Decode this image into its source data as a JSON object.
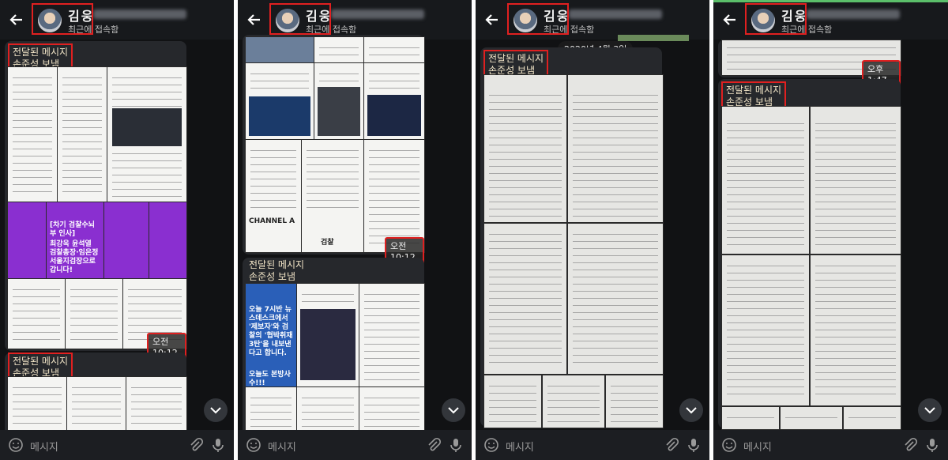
{
  "chat": {
    "contact_name": "김웅",
    "status": "최근에 접속함",
    "input_placeholder": "메시지",
    "forwarded_from": "전달된 메시지\n손준성 보냄"
  },
  "panels": [
    {
      "timestamps": [
        "오전 10:12"
      ]
    },
    {
      "timestamps": [
        "오전 10:12"
      ],
      "tile_texts": [
        "[차기 검찰수뇌부 인사]",
        "최강욱 윤석열 검찰총장·임은정 서울지검장으로 갑니다!"
      ],
      "news_texts": [
        "오늘 7시반 뉴스데스크에서 '제보자'와 검찰의 '협박취재 3탄'을 내보낸다고 합니다.",
        "오늘도 본방사수!!!",
        "CHANNEL A",
        "검찰"
      ]
    },
    {
      "date_label": "2020년 4월 3일"
    },
    {
      "timestamps": [
        "오후 1:47"
      ]
    }
  ],
  "icons": [
    "back-arrow-icon",
    "emoji-icon",
    "attach-icon",
    "mic-icon",
    "chevron-down-icon"
  ],
  "colors": {
    "highlight": "#e02020",
    "panel_bg": "#111214",
    "bubble_bg": "#26282c"
  }
}
